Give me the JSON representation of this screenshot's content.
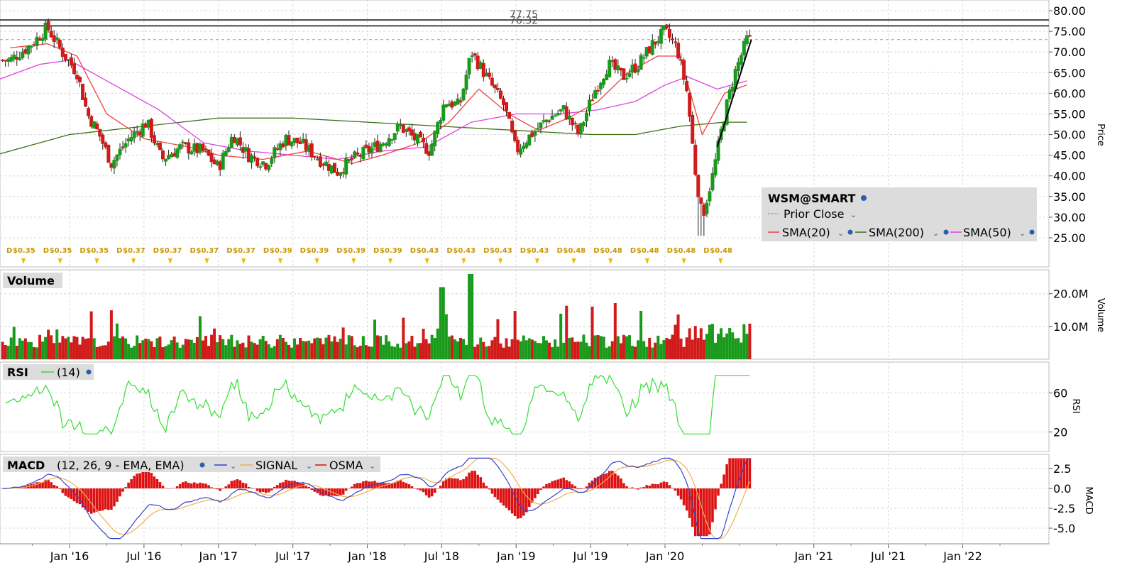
{
  "chart_data": [
    {
      "type": "candlestick",
      "symbol": "WSM@SMART",
      "ylabel": "Price",
      "ylim": [
        20,
        80
      ],
      "yticks": [
        "80.00",
        "75.00",
        "70.00",
        "65.00",
        "60.00",
        "55.00",
        "50.00",
        "45.00",
        "40.00",
        "35.00",
        "30.00",
        "25.00"
      ],
      "horizontal_lines": [
        {
          "label": "77.75",
          "value": 77.75
        },
        {
          "label": "76.32",
          "value": 76.32
        }
      ],
      "prior_close": 73.0,
      "legend": {
        "title": "WSM@SMART",
        "prior_close": "Prior Close",
        "items": [
          "SMA(20)",
          "SMA(200)",
          "SMA(50)"
        ]
      },
      "colors": {
        "up": "#1a9a1a",
        "down": "#d11a1a",
        "sma20": "#f04040",
        "sma200": "#3c6e14",
        "sma50": "#e040e0"
      },
      "dividends": [
        "$0.35",
        "$0.35",
        "$0.35",
        "$0.37",
        "$0.37",
        "$0.37",
        "$0.37",
        "$0.39",
        "$0.39",
        "$0.39",
        "$0.39",
        "$0.43",
        "$0.43",
        "$0.43",
        "$0.43",
        "$0.48",
        "$0.48",
        "$0.48",
        "$0.48",
        "$0.48"
      ],
      "dividend_marker": "D",
      "close_series": [
        [
          2015.6,
          68
        ],
        [
          2015.75,
          72
        ],
        [
          2015.85,
          76
        ],
        [
          2015.95,
          70
        ],
        [
          2016.05,
          65
        ],
        [
          2016.12,
          55
        ],
        [
          2016.2,
          50
        ],
        [
          2016.28,
          43
        ],
        [
          2016.4,
          49
        ],
        [
          2016.52,
          53
        ],
        [
          2016.62,
          44
        ],
        [
          2016.75,
          47
        ],
        [
          2016.9,
          46
        ],
        [
          2017.0,
          42
        ],
        [
          2017.1,
          50
        ],
        [
          2017.2,
          45
        ],
        [
          2017.32,
          43
        ],
        [
          2017.45,
          49
        ],
        [
          2017.55,
          48
        ],
        [
          2017.68,
          44
        ],
        [
          2017.8,
          41
        ],
        [
          2017.9,
          44
        ],
        [
          2018.0,
          46
        ],
        [
          2018.1,
          48
        ],
        [
          2018.22,
          52
        ],
        [
          2018.32,
          49
        ],
        [
          2018.42,
          46
        ],
        [
          2018.52,
          58
        ],
        [
          2018.62,
          57
        ],
        [
          2018.7,
          70
        ],
        [
          2018.8,
          64
        ],
        [
          2018.92,
          57
        ],
        [
          2019.0,
          46
        ],
        [
          2019.1,
          50
        ],
        [
          2019.22,
          54
        ],
        [
          2019.32,
          56
        ],
        [
          2019.42,
          50
        ],
        [
          2019.52,
          60
        ],
        [
          2019.62,
          67
        ],
        [
          2019.72,
          64
        ],
        [
          2019.82,
          67
        ],
        [
          2019.92,
          72
        ],
        [
          2020.0,
          75
        ],
        [
          2020.08,
          71
        ],
        [
          2020.15,
          60
        ],
        [
          2020.2,
          42
        ],
        [
          2020.25,
          30
        ],
        [
          2020.32,
          40
        ],
        [
          2020.4,
          55
        ],
        [
          2020.47,
          65
        ],
        [
          2020.55,
          73
        ]
      ],
      "sma20": [
        [
          2015.6,
          71
        ],
        [
          2015.85,
          72
        ],
        [
          2016.05,
          69
        ],
        [
          2016.25,
          55
        ],
        [
          2016.5,
          49
        ],
        [
          2016.8,
          47
        ],
        [
          2017.0,
          45
        ],
        [
          2017.3,
          44
        ],
        [
          2017.6,
          46
        ],
        [
          2017.9,
          43
        ],
        [
          2018.1,
          45
        ],
        [
          2018.35,
          48
        ],
        [
          2018.55,
          53
        ],
        [
          2018.75,
          61
        ],
        [
          2018.95,
          55
        ],
        [
          2019.15,
          51
        ],
        [
          2019.35,
          54
        ],
        [
          2019.55,
          58
        ],
        [
          2019.75,
          65
        ],
        [
          2019.95,
          69
        ],
        [
          2020.1,
          69
        ],
        [
          2020.25,
          50
        ],
        [
          2020.4,
          60
        ],
        [
          2020.55,
          62
        ]
      ],
      "sma50": [
        [
          2015.5,
          63
        ],
        [
          2015.8,
          67
        ],
        [
          2016.0,
          68
        ],
        [
          2016.3,
          62
        ],
        [
          2016.6,
          56
        ],
        [
          2016.9,
          48
        ],
        [
          2017.2,
          46
        ],
        [
          2017.5,
          45
        ],
        [
          2017.8,
          44
        ],
        [
          2018.1,
          46
        ],
        [
          2018.4,
          47
        ],
        [
          2018.7,
          53
        ],
        [
          2019.0,
          55
        ],
        [
          2019.3,
          55
        ],
        [
          2019.55,
          56
        ],
        [
          2019.8,
          58
        ],
        [
          2020.0,
          62
        ],
        [
          2020.15,
          64
        ],
        [
          2020.35,
          61
        ],
        [
          2020.55,
          63
        ]
      ],
      "sma200": [
        [
          2015.5,
          45
        ],
        [
          2016.0,
          50
        ],
        [
          2016.5,
          52
        ],
        [
          2017.0,
          54
        ],
        [
          2017.5,
          54
        ],
        [
          2018.0,
          53
        ],
        [
          2018.5,
          52
        ],
        [
          2019.0,
          51
        ],
        [
          2019.5,
          50
        ],
        [
          2019.8,
          50
        ],
        [
          2020.1,
          52
        ],
        [
          2020.4,
          53
        ],
        [
          2020.55,
          53
        ]
      ],
      "trend_line": [
        [
          2020.35,
          47
        ],
        [
          2020.58,
          73
        ]
      ]
    },
    {
      "type": "bar",
      "title": "Volume",
      "ylabel": "Volume",
      "yticks": [
        "20.0M",
        "10.0M"
      ],
      "ylim": [
        0,
        26000000
      ]
    },
    {
      "type": "line",
      "title": "RSI",
      "params": "(14)",
      "ylabel": "RSI",
      "yticks": [
        "60",
        "20"
      ],
      "ylim": [
        0,
        80
      ],
      "color": "#33dd33"
    },
    {
      "type": "line",
      "title": "MACD",
      "params": "(12, 26, 9 - EMA, EMA)",
      "legend": [
        "SIGNAL",
        "OSMA"
      ],
      "ylabel": "MACD",
      "yticks": [
        "2.5",
        "0.0",
        "-2.5",
        "-5.0"
      ],
      "ylim": [
        -6.5,
        4
      ],
      "colors": {
        "macd": "#3344cc",
        "signal": "#f0b050",
        "osma": "#dd1111"
      }
    }
  ],
  "x_axis": {
    "labels": [
      "Jan '16",
      "Jul '16",
      "Jan '17",
      "Jul '17",
      "Jan '18",
      "Jul '18",
      "Jan '19",
      "Jul '19",
      "Jan '20",
      "Jan '21",
      "Jul '21",
      "Jan '22"
    ]
  }
}
